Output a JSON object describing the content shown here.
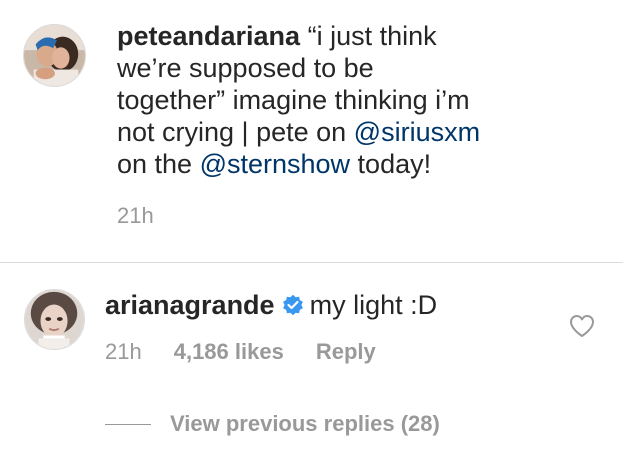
{
  "caption": {
    "username": "peteandariana",
    "text_before": " “i just think\nwe’re supposed to be\ntogether” imagine thinking i’m\nnot crying | pete on ",
    "mention_1": "@siriusxm",
    "text_middle": "\non the ",
    "mention_2": "@sternshow",
    "text_after": " today!",
    "timestamp": "21h",
    "avatar_icon": "couple-photo-avatar"
  },
  "comment": {
    "username": "arianagrande",
    "verified_icon": "verified-badge-icon",
    "text": "my light :D",
    "timestamp": "21h",
    "likes": "4,186 likes",
    "reply_label": "Reply",
    "like_icon": "heart-outline-icon",
    "avatar_icon": "selfie-avatar"
  },
  "replies": {
    "view_label": "View previous replies (28)"
  },
  "colors": {
    "text": "#262626",
    "secondary": "#999999",
    "mention": "#003569",
    "verified": "#3897f0",
    "divider": "#dbdbdb"
  }
}
